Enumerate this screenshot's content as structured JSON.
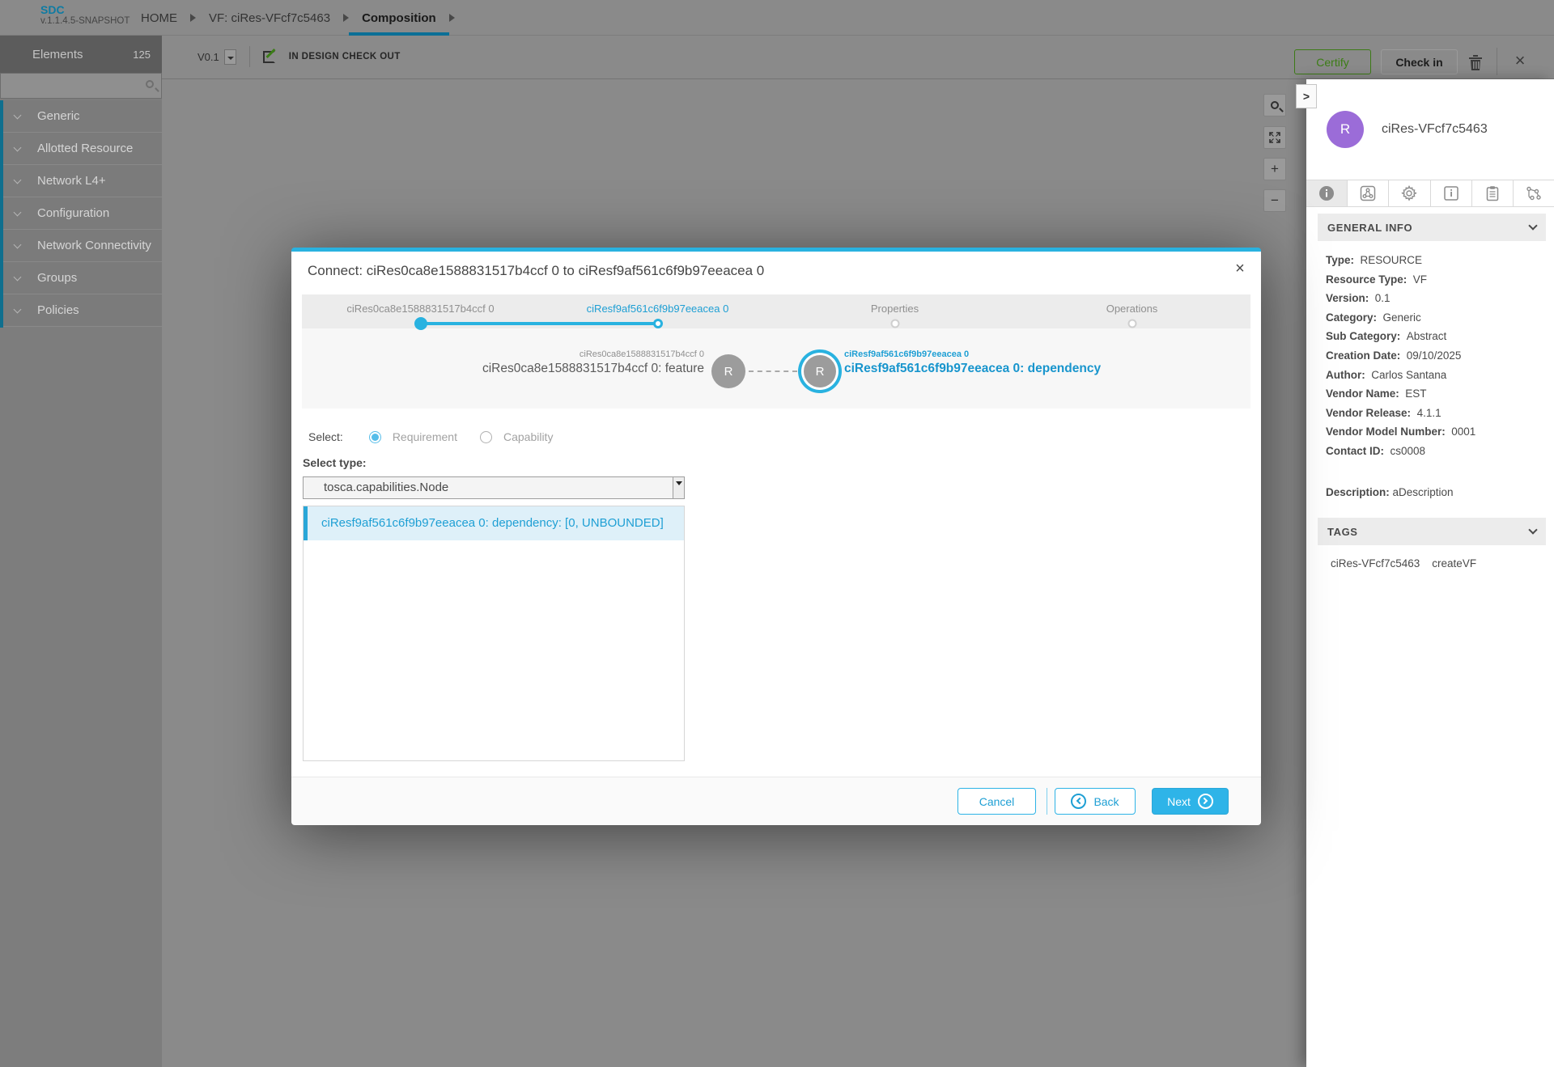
{
  "app": {
    "logo": "SDC",
    "version": "v.1.1.4.5-SNAPSHOT"
  },
  "breadcrumb": {
    "items": [
      "HOME",
      "VF: ciRes-VFcf7c5463",
      "Composition"
    ]
  },
  "palette": {
    "title": "Elements",
    "count": "125",
    "search_placeholder": "",
    "categories": [
      "Generic",
      "Allotted Resource",
      "Network L4+",
      "Configuration",
      "Network Connectivity",
      "Groups",
      "Policies"
    ]
  },
  "canvas_header": {
    "version": "V0.1",
    "status": "IN DESIGN CHECK OUT",
    "certify": "Certify",
    "checkin": "Check in",
    "close": "×"
  },
  "canvas_tools": {
    "zoom_in": "+",
    "zoom_out": "−"
  },
  "modal": {
    "title": "Connect: ciRes0ca8e1588831517b4ccf 0 to ciResf9af561c6f9b97eeacea 0",
    "close": "×",
    "steps": [
      {
        "label": "ciRes0ca8e1588831517b4ccf 0",
        "state": "done"
      },
      {
        "label": "ciResf9af561c6f9b97eeacea 0",
        "state": "active"
      },
      {
        "label": "Properties",
        "state": "pending"
      },
      {
        "label": "Operations",
        "state": "pending"
      }
    ],
    "link": {
      "from": {
        "badge": "R",
        "name": "ciRes0ca8e1588831517b4ccf 0",
        "endpoint": "ciRes0ca8e1588831517b4ccf 0: feature"
      },
      "to": {
        "badge": "R",
        "name": "ciResf9af561c6f9b97eeacea 0",
        "endpoint": "ciResf9af561c6f9b97eeacea 0: dependency"
      }
    },
    "select_label": "Select:",
    "radios": [
      {
        "label": "Requirement",
        "checked": true
      },
      {
        "label": "Capability",
        "checked": false
      }
    ],
    "select_type_label": "Select type:",
    "select_type_value": "tosca.capabilities.Node",
    "list_items": [
      {
        "label": "ciResf9af561c6f9b97eeacea 0: dependency: [0, UNBOUNDED]",
        "selected": true
      }
    ],
    "footer": {
      "cancel": "Cancel",
      "back": "Back",
      "next": "Next"
    }
  },
  "right_panel": {
    "expander": ">",
    "avatar_letter": "R",
    "avatar_color": "#9b6cd8",
    "title": "ciRes-VFcf7c5463",
    "tab_icons": [
      "info-filled-icon",
      "hierarchy-icon",
      "gear-icon",
      "info-square-icon",
      "clipboard-icon",
      "network-tree-icon"
    ],
    "general_info": {
      "heading": "GENERAL INFO",
      "fields": [
        {
          "label": "Type:",
          "value": "RESOURCE"
        },
        {
          "label": "Resource Type:",
          "value": "VF"
        },
        {
          "label": "Version:",
          "value": "0.1"
        },
        {
          "label": "Category:",
          "value": "Generic"
        },
        {
          "label": "Sub Category:",
          "value": "Abstract"
        },
        {
          "label": "Creation Date:",
          "value": "09/10/2025"
        },
        {
          "label": "Author:",
          "value": "Carlos Santana"
        },
        {
          "label": "Vendor Name:",
          "value": "EST"
        },
        {
          "label": "Vendor Release:",
          "value": "4.1.1"
        },
        {
          "label": "Vendor Model Number:",
          "value": "0001"
        },
        {
          "label": "Contact ID:",
          "value": "cs0008"
        }
      ],
      "description_label": "Description:",
      "description_value": "aDescription"
    },
    "tags": {
      "heading": "TAGS",
      "values": [
        "ciRes-VFcf7c5463",
        "createVF"
      ]
    }
  },
  "colors": {
    "accent_blue": "#29b2e0",
    "accent_text_blue": "#1e9fd4",
    "certify_green": "#3c7d15",
    "breadcrumb_underline": "#0b6f96",
    "avatar_purple": "#9b6cd8",
    "palette_accent_teal": "#0f6f8e"
  }
}
